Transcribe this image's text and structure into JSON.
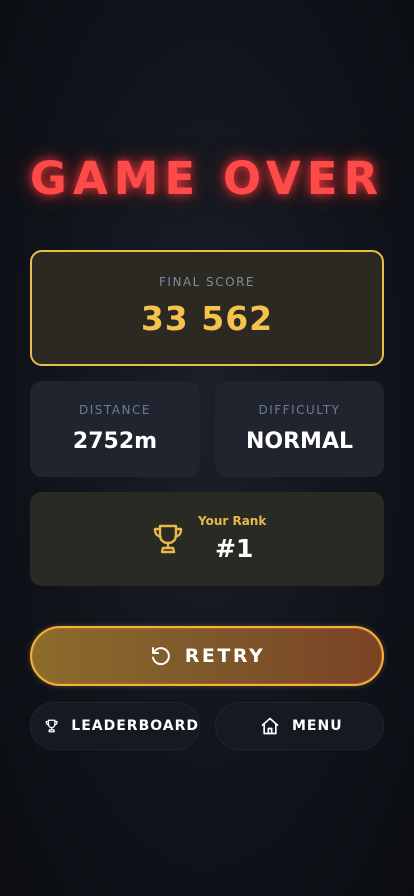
{
  "title": "GAME OVER",
  "final_score": {
    "label": "FINAL SCORE",
    "value": "33 562"
  },
  "stats": {
    "distance": {
      "label": "DISTANCE",
      "value": "2752m"
    },
    "difficulty": {
      "label": "DIFFICULTY",
      "value": "NORMAL"
    }
  },
  "rank": {
    "label": "Your Rank",
    "value": "#1",
    "icon": "trophy-icon"
  },
  "buttons": {
    "retry": {
      "label": "RETRY",
      "icon": "retry-icon"
    },
    "leaderboard": {
      "label": "LEADERBOARD",
      "icon": "trophy-icon"
    },
    "menu": {
      "label": "MENU",
      "icon": "home-icon"
    }
  },
  "colors": {
    "title": "#ff4a4a",
    "accent_gold": "#f4c24d",
    "retry_border": "#f2b33d",
    "background": "#10141b"
  }
}
